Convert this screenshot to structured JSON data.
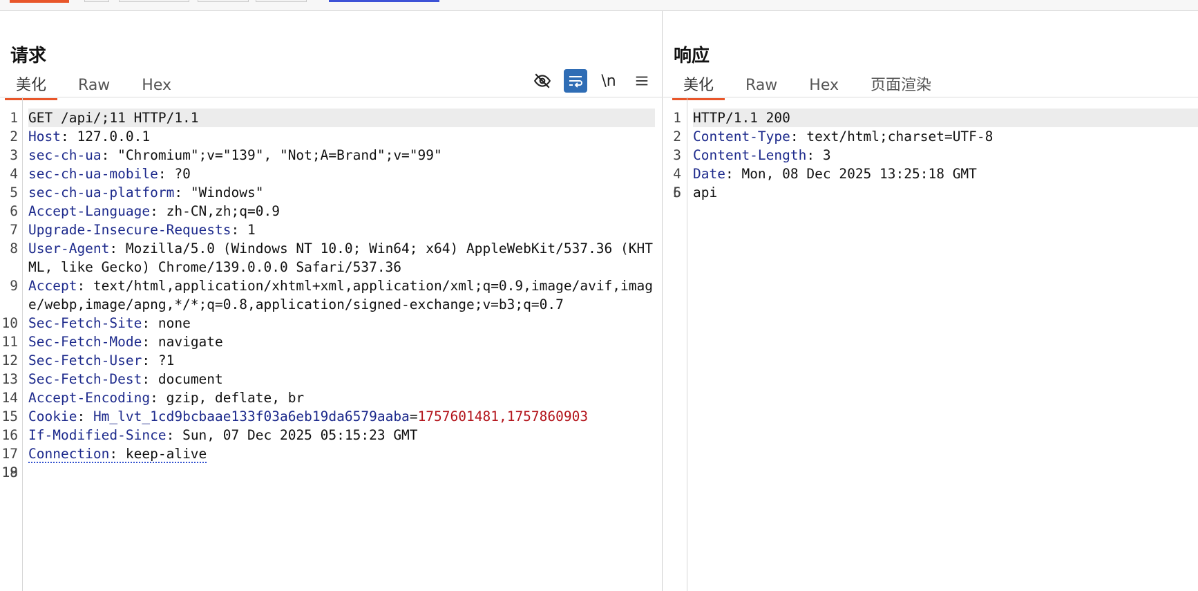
{
  "request": {
    "title": "请求",
    "tabs": [
      {
        "label": "美化"
      },
      {
        "label": "Raw"
      },
      {
        "label": "Hex"
      }
    ],
    "tools": {
      "hide": "eye-off-icon",
      "wrap": "wrap-icon",
      "newline": "\\n",
      "menu": "menu-icon"
    },
    "lines": [
      {
        "n": "1",
        "text": "GET /api/;11 HTTP/1.1"
      },
      {
        "n": "2",
        "name": "Host",
        "value": "127.0.0.1"
      },
      {
        "n": "3",
        "name": "sec-ch-ua",
        "value": "\"Chromium\";v=\"139\", \"Not;A=Brand\";v=\"99\""
      },
      {
        "n": "4",
        "name": "sec-ch-ua-mobile",
        "value": "?0"
      },
      {
        "n": "5",
        "name": "sec-ch-ua-platform",
        "value": "\"Windows\""
      },
      {
        "n": "6",
        "name": "Accept-Language",
        "value": "zh-CN,zh;q=0.9"
      },
      {
        "n": "7",
        "name": "Upgrade-Insecure-Requests",
        "value": "1"
      },
      {
        "n": "8",
        "name": "User-Agent",
        "value": "Mozilla/5.0 (Windows NT 10.0; Win64; x64) AppleWebKit/537.36 (KHTML, like Gecko) Chrome/139.0.0.0 Safari/537.36"
      },
      {
        "n": "9",
        "name": "Accept",
        "value": "text/html,application/xhtml+xml,application/xml;q=0.9,image/avif,image/webp,image/apng,*/*;q=0.8,application/signed-exchange;v=b3;q=0.7"
      },
      {
        "n": "10",
        "name": "Sec-Fetch-Site",
        "value": "none"
      },
      {
        "n": "11",
        "name": "Sec-Fetch-Mode",
        "value": "navigate"
      },
      {
        "n": "12",
        "name": "Sec-Fetch-User",
        "value": "?1"
      },
      {
        "n": "13",
        "name": "Sec-Fetch-Dest",
        "value": "document"
      },
      {
        "n": "14",
        "name": "Accept-Encoding",
        "value": "gzip, deflate, br"
      },
      {
        "n": "15",
        "name": "Cookie",
        "cookie_name": "Hm_lvt_1cd9bcbaae133f03a6eb19da6579aaba",
        "cookie_value": "1757601481,1757860903"
      },
      {
        "n": "16",
        "name": "If-Modified-Since",
        "value": "Sun, 07 Dec 2025 05:15:23 GMT"
      },
      {
        "n": "17",
        "name": "Connection",
        "value": "keep-alive"
      },
      {
        "n": "18",
        "text": ""
      },
      {
        "n": "19",
        "text": ""
      }
    ]
  },
  "response": {
    "title": "响应",
    "tabs": [
      {
        "label": "美化"
      },
      {
        "label": "Raw"
      },
      {
        "label": "Hex"
      },
      {
        "label": "页面渲染"
      }
    ],
    "lines": [
      {
        "n": "1",
        "text": "HTTP/1.1 200"
      },
      {
        "n": "2",
        "name": "Content-Type",
        "value": "text/html;charset=UTF-8"
      },
      {
        "n": "3",
        "name": "Content-Length",
        "value": "3"
      },
      {
        "n": "4",
        "name": "Date",
        "value": "Mon, 08 Dec 2025 13:25:18 GMT"
      },
      {
        "n": "5",
        "text": ""
      },
      {
        "n": "6",
        "text": "api"
      }
    ]
  }
}
